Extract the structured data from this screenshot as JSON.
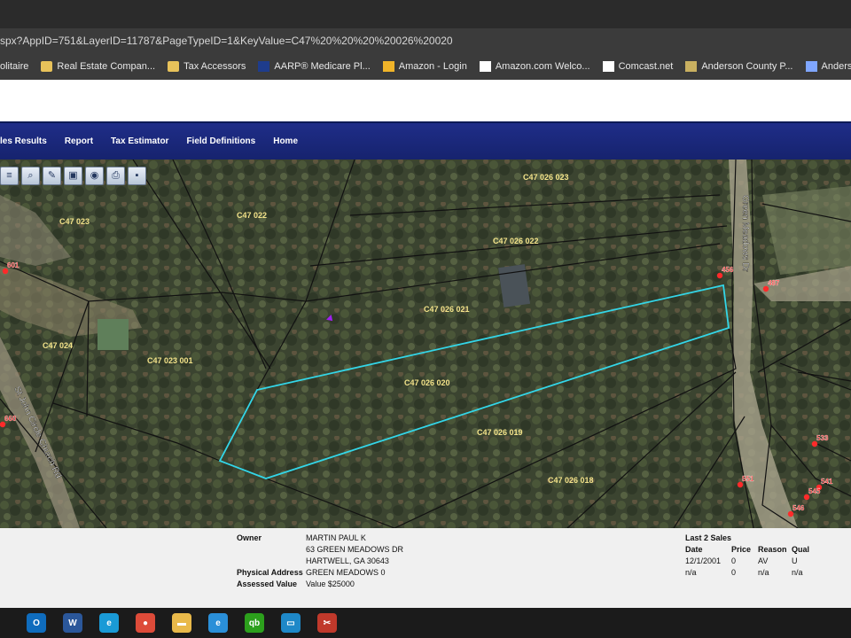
{
  "browser": {
    "url": "spx?AppID=751&LayerID=11787&PageTypeID=1&KeyValue=C47%20%20%20%20026%20020",
    "bookmarks": [
      {
        "label": "olitaire",
        "icon": "solitaire-icon"
      },
      {
        "label": "Real Estate Compan...",
        "icon": "folder-icon"
      },
      {
        "label": "Tax Accessors",
        "icon": "folder-icon"
      },
      {
        "label": "AARP® Medicare Pl...",
        "icon": "shield-icon"
      },
      {
        "label": "Amazon - Login",
        "icon": "bar-chart-icon"
      },
      {
        "label": "Amazon.com Welco...",
        "icon": "amazon-icon"
      },
      {
        "label": "Comcast.net",
        "icon": "x-icon"
      },
      {
        "label": "Anderson County P...",
        "icon": "county-seal-icon"
      },
      {
        "label": "Anderson Cty SC Re...",
        "icon": "letter-a-icon"
      }
    ]
  },
  "nav": {
    "items": [
      "les Results",
      "Report",
      "Tax Estimator",
      "Field Definitions",
      "Home"
    ]
  },
  "map": {
    "tools": [
      "layers-icon",
      "zoom-icon",
      "measure-icon",
      "select-icon",
      "identify-icon",
      "print-icon",
      "save-icon"
    ],
    "parcel_labels": [
      {
        "text": "C47    026 023"
      },
      {
        "text": "C47    022"
      },
      {
        "text": "C47    023"
      },
      {
        "text": "C47    026 022"
      },
      {
        "text": "C47    026 021"
      },
      {
        "text": "C47    024"
      },
      {
        "text": "C47    023 001"
      },
      {
        "text": "C47    026 020"
      },
      {
        "text": "C47    026 019"
      },
      {
        "text": "C47    026 018"
      }
    ],
    "road_labels": [
      "Green Meadows Dr",
      "St John Circle Church Rd"
    ],
    "address_markers": [
      "456",
      "487",
      "601",
      "660",
      "533",
      "551",
      "541",
      "545",
      "546"
    ],
    "highlight_color": "#33d6e8",
    "line_color": "#111111",
    "marker_color": "#ff2a2a"
  },
  "info": {
    "owner_label": "Owner",
    "owner_name": "MARTIN PAUL K",
    "owner_addr1": "63 GREEN MEADOWS DR",
    "owner_addr2": "HARTWELL, GA 30643",
    "phys_label": "Physical Address",
    "phys_value": "GREEN MEADOWS 0",
    "assessed_label": "Assessed Value",
    "assessed_value": "Value $25000",
    "sales_title": "Last 2 Sales",
    "sales_headers": [
      "Date",
      "Price",
      "Reason",
      "Qual"
    ],
    "sales_rows": [
      [
        "12/1/2001",
        "0",
        "AV",
        "U"
      ],
      [
        "n/a",
        "0",
        "n/a",
        "n/a"
      ]
    ]
  },
  "taskbar": {
    "apps": [
      {
        "name": "outlook-icon",
        "letter": "O",
        "color": "#0f6cbd"
      },
      {
        "name": "word-icon",
        "letter": "W",
        "color": "#2b579a"
      },
      {
        "name": "edge-icon",
        "letter": "e",
        "color": "#1a9ad6"
      },
      {
        "name": "chrome-icon",
        "letter": "●",
        "color": "#dd4b39"
      },
      {
        "name": "file-explorer-icon",
        "letter": "▬",
        "color": "#e9b94a"
      },
      {
        "name": "internet-explorer-icon",
        "letter": "e",
        "color": "#2a8fd8"
      },
      {
        "name": "quickbooks-icon",
        "letter": "qb",
        "color": "#2ca01c"
      },
      {
        "name": "remote-desktop-icon",
        "letter": "▭",
        "color": "#1e88c8"
      },
      {
        "name": "snipping-tool-icon",
        "letter": "✂",
        "color": "#c0392b"
      }
    ]
  }
}
